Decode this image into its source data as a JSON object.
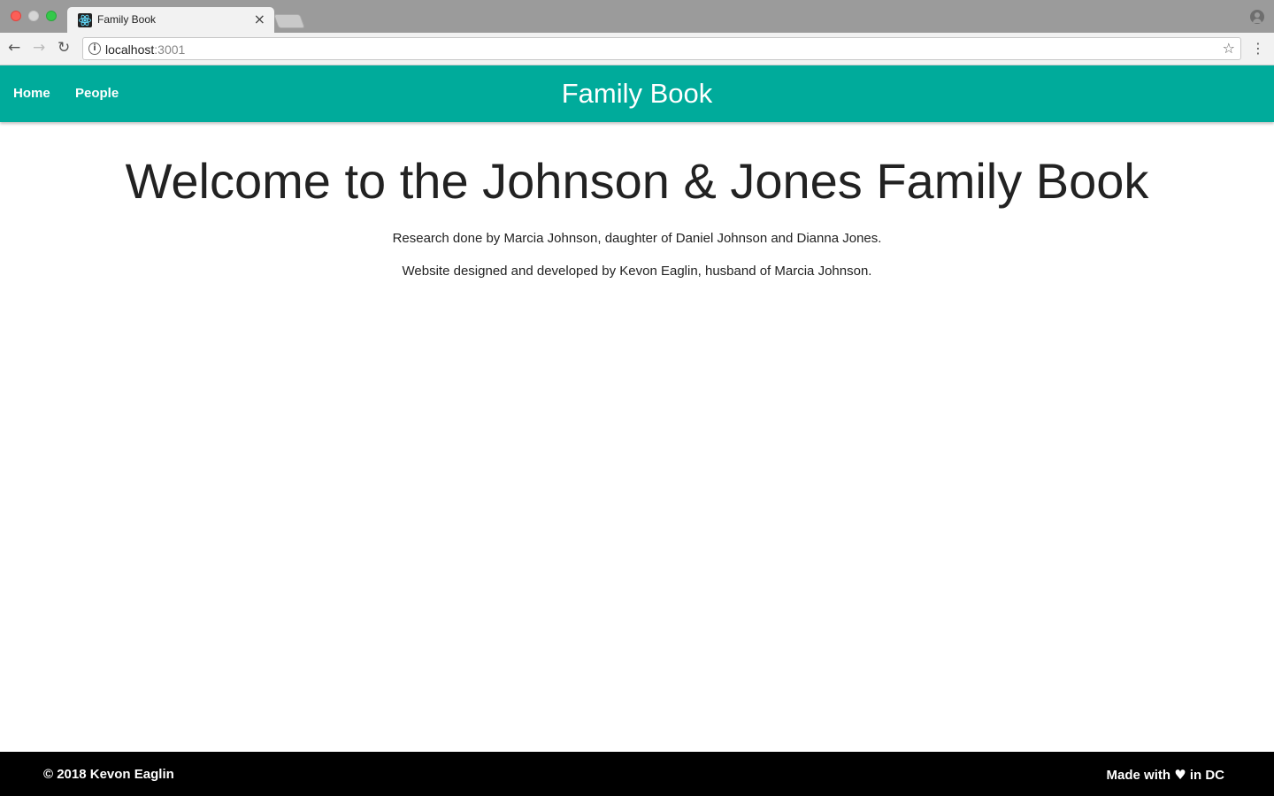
{
  "browser": {
    "tab_title": "Family Book",
    "tab_close": "×",
    "url_host": "localhost",
    "url_port": ":3001",
    "back_icon": "←",
    "forward_icon": "→",
    "reload_icon": "↻",
    "info_icon": "i",
    "star_icon": "☆",
    "menu_icon": "⋮"
  },
  "navbar": {
    "links": [
      {
        "label": "Home"
      },
      {
        "label": "People"
      }
    ],
    "brand": "Family Book",
    "background": "#00ab9b"
  },
  "main": {
    "heading": "Welcome to the Johnson & Jones Family Book",
    "paragraphs": [
      "Research done by Marcia Johnson, daughter of Daniel Johnson and Dianna Jones.",
      "Website designed and developed by Kevon Eaglin, husband of Marcia Johnson."
    ]
  },
  "footer": {
    "copyright": "© 2018 Kevon Eaglin",
    "made_prefix": "Made with",
    "heart": "♥",
    "made_suffix": "in DC"
  }
}
